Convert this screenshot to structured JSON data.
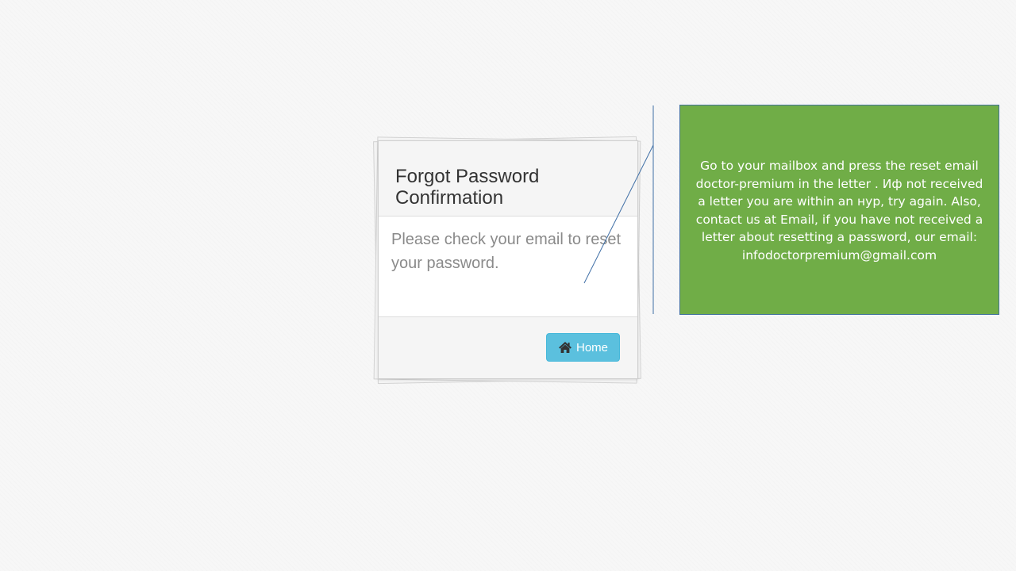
{
  "dialog": {
    "title": "Forgot Password Confirmation",
    "message": "Please check your email to reset your password.",
    "home_button_label": "Home",
    "home_icon": "home-icon"
  },
  "note": {
    "text": "Go to your mailbox and press the reset email doctor-premium in the letter . Иф not received a letter you are within an нур, try again. Also, contact us at Email, if you have not received a letter about resetting a password, our email: infodoctorpremium@gmail.com"
  },
  "colors": {
    "note_background": "#70ad47",
    "note_border": "#41719c",
    "callout_line": "#3f6fa6",
    "button_background": "#5bc0de",
    "title_text": "#333333",
    "message_text": "#8a8a8a"
  }
}
